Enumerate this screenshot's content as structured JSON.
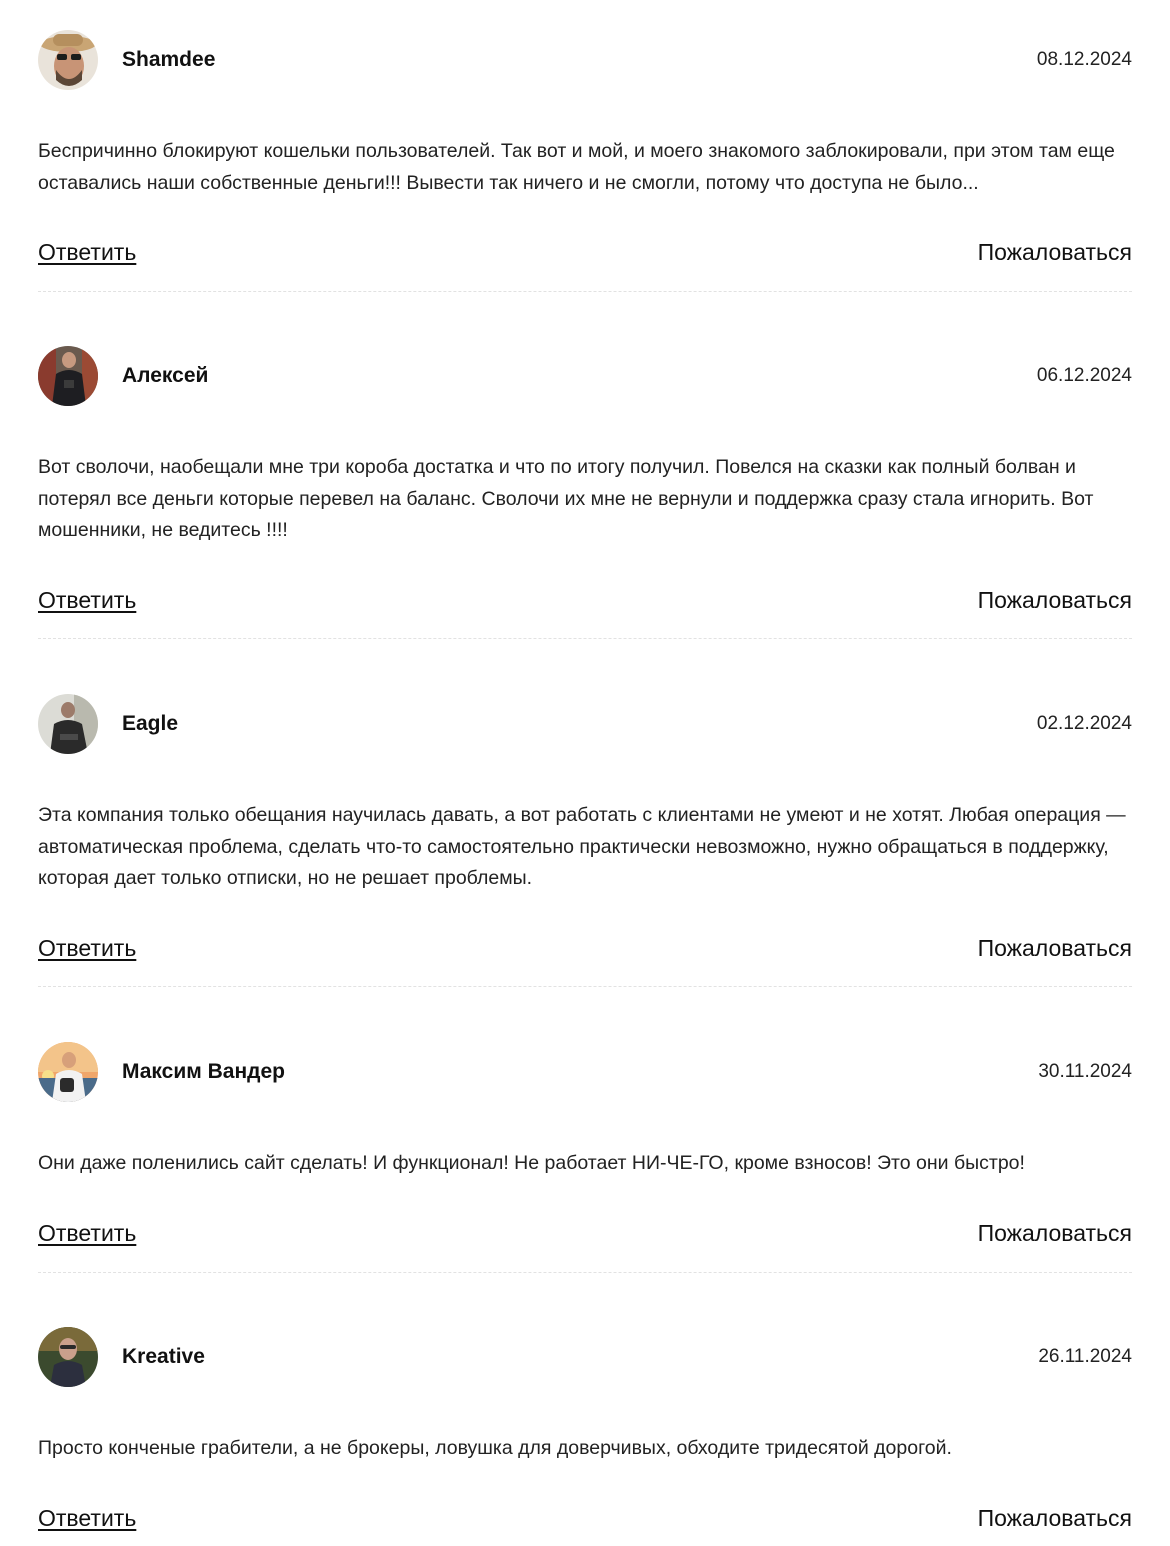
{
  "comments": [
    {
      "author": "Shamdee",
      "date": "08.12.2024",
      "text": "Беспричинно блокируют кошельки пользователей. Так вот и мой, и моего знакомого заблокировали, при этом там еще оставались наши собственные деньги!!! Вывести так ничего и не смогли, потому что доступа не было...",
      "reply_label": "Ответить",
      "report_label": "Пожаловаться"
    },
    {
      "author": "Алексей",
      "date": "06.12.2024",
      "text": "Вот сволочи, наобещали мне три короба достатка и что по итогу получил. Повелся на сказки как полный болван и потерял все деньги которые перевел на баланс. Сволочи их мне не вернули и поддержка сразу стала игнорить. Вот мошенники, не ведитесь !!!!",
      "reply_label": "Ответить",
      "report_label": "Пожаловаться"
    },
    {
      "author": "Eagle",
      "date": "02.12.2024",
      "text": "Эта компания только обещания научилась давать, а вот работать с клиентами не умеют и не хотят. Любая операция — автоматическая проблема, сделать что-то самостоятельно практически невозможно, нужно обращаться в поддержку, которая дает только отписки, но не решает проблемы.",
      "reply_label": "Ответить",
      "report_label": "Пожаловаться"
    },
    {
      "author": "Максим Вандер",
      "date": "30.11.2024",
      "text": "Они даже поленились сайт сделать! И функционал! Не работает НИ-ЧЕ-ГО, кроме взносов! Это они быстро!",
      "reply_label": "Ответить",
      "report_label": "Пожаловаться"
    },
    {
      "author": "Kreative",
      "date": "26.11.2024",
      "text": "Просто конченые грабители, а не брокеры, ловушка для доверчивых, обходите тридесятой дорогой.",
      "reply_label": "Ответить",
      "report_label": "Пожаловаться"
    }
  ]
}
